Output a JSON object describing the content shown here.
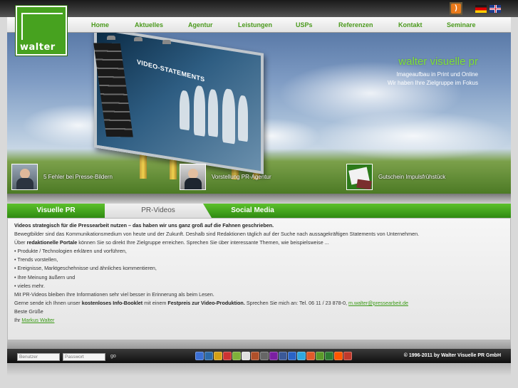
{
  "window": {
    "title": "walter visuelle pr"
  },
  "header": {
    "logo_text": "walter",
    "lang_icons": [
      "rss-icon",
      "flag-de-icon",
      "flag-uk-icon"
    ]
  },
  "nav": {
    "items": [
      "Home",
      "Aktuelles",
      "Agentur",
      "Leistungen",
      "USPs",
      "Referenzen",
      "Kontakt",
      "Seminare"
    ]
  },
  "hero": {
    "headline": "walter visuelle pr",
    "sub1": "Imageaufbau in Print und Online",
    "sub2": "Wir haben Ihre Zielgruppe im Fokus",
    "billboard_text": "VIDEO-STATEMENTS",
    "teasers": [
      {
        "label": "5 Fehler bei Presse-Bildern"
      },
      {
        "label": "Vorstellung PR-Agentur"
      },
      {
        "label": "Gutschein Impulsfrühstück"
      }
    ]
  },
  "tabs": [
    {
      "label": "Visuelle PR",
      "active": false
    },
    {
      "label": "PR-Videos",
      "active": true
    },
    {
      "label": "Social Media",
      "active": false
    }
  ],
  "content": {
    "heading": "Videos strategisch für die Pressearbeit nutzen – das haben wir uns ganz groß auf die Fahnen geschrieben.",
    "p1": "Bewegtbilder sind das Kommunikationsmedium von heute und der Zukunft. Deshalb sind Redaktionen täglich auf der Suche nach aussagekräftigen Statements von Unternehmen.",
    "p2_pre": "Über ",
    "p2_bold": "redaktionelle Portale",
    "p2_post": " können Sie so direkt Ihre Zielgruppe erreichen. Sprechen Sie über interessante Themen, wie beispielsweise ...",
    "bullets": [
      "• Produkte / Technologien erklären und vorführen,",
      "• Trends vorstellen,",
      "• Ereignisse, Marktgeschehnisse und ähnliches kommentieren,",
      "• Ihre Meinung äußern und",
      "• vieles mehr."
    ],
    "p3": "Mit PR-Videos bleiben Ihre Informationen sehr viel besser in Erinnerung als beim Lesen.",
    "p4_pre": "Gerne sende ich Ihnen unser ",
    "p4_bold1": "kostenloses Info-Booklet",
    "p4_mid": " mit einem ",
    "p4_bold2": "Festpreis zur Video-Produktion.",
    "p4_post": " Sprechen Sie mich an: Tel. 06 11 / 23 878-0, ",
    "p4_email": "m.walter@pressearbeit.de",
    "greeting": "Beste Grüße",
    "sign_pre": "Ihr ",
    "sign_link": "Markus Walter"
  },
  "footer": {
    "user_placeholder": "Benutzer",
    "pass_placeholder": "Passwort",
    "go_label": "go",
    "copyright": "© 1996-2011 by Walter Visuelle PR GmbH",
    "bookmarks": [
      {
        "icon": "delicious-icon",
        "color": "#3b6fd3"
      },
      {
        "icon": "digg-icon",
        "color": "#2d6aa8"
      },
      {
        "icon": "mister-wong-icon",
        "color": "#d4a017"
      },
      {
        "icon": "webnews-icon",
        "color": "#c33"
      },
      {
        "icon": "yigg-icon",
        "color": "#7fb13a"
      },
      {
        "icon": "google-icon",
        "color": "#e0e0e0"
      },
      {
        "icon": "linkarena-icon",
        "color": "#b0502a"
      },
      {
        "icon": "oneview-icon",
        "color": "#666"
      },
      {
        "icon": "yahoo-icon",
        "color": "#7b1fa2"
      },
      {
        "icon": "facebook-icon",
        "color": "#3b5998"
      },
      {
        "icon": "myspace-icon",
        "color": "#2a63c6"
      },
      {
        "icon": "twitter-icon",
        "color": "#2fa8e0"
      },
      {
        "icon": "stumbleupon-icon",
        "color": "#e05a2a"
      },
      {
        "icon": "technorati-icon",
        "color": "#5b9a2a"
      },
      {
        "icon": "newsvine-icon",
        "color": "#2e7d32"
      },
      {
        "icon": "reddit-icon",
        "color": "#ff5700"
      },
      {
        "icon": "mail-icon",
        "color": "#c0392b"
      }
    ]
  }
}
